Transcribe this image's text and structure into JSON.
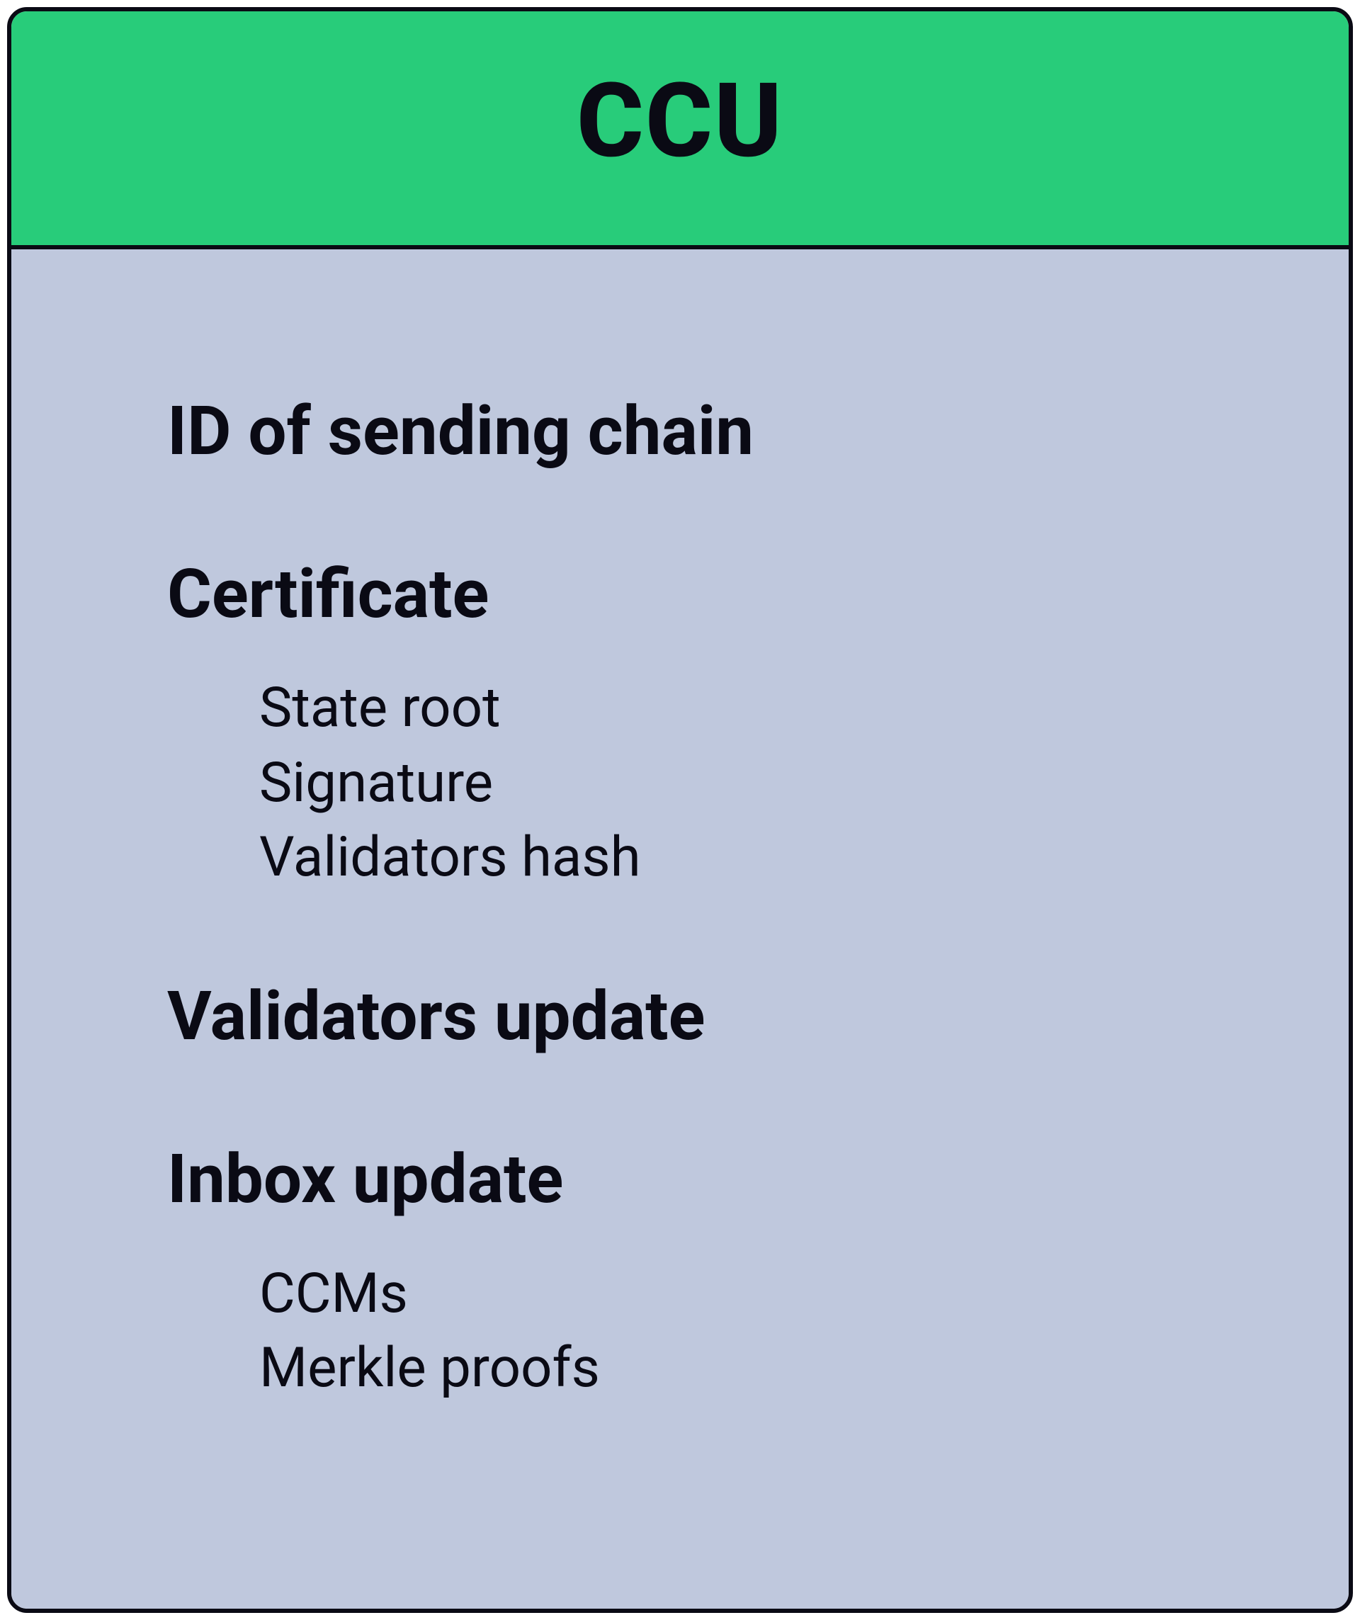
{
  "header": {
    "title": "CCU"
  },
  "sections": [
    {
      "title": "ID of sending chain",
      "items": []
    },
    {
      "title": "Certificate",
      "items": [
        "State root",
        "Signature",
        "Validators hash"
      ]
    },
    {
      "title": "Validators update",
      "items": []
    },
    {
      "title": "Inbox update",
      "items": [
        "CCMs",
        "Merkle proofs"
      ]
    }
  ]
}
